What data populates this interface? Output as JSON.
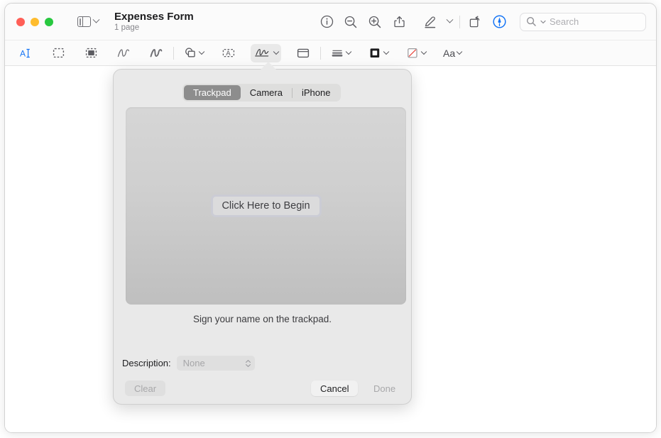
{
  "window": {
    "title": "Expenses Form",
    "subtitle": "1 page"
  },
  "traffic_lights": {
    "close": "close-button",
    "minimize": "minimize-button",
    "maximize": "maximize-button",
    "colors": {
      "close": "#ff5f57",
      "minimize": "#febc2e",
      "maximize": "#28c840"
    }
  },
  "titlebar": {
    "sidebar_toggle": "sidebar-toggle",
    "buttons": [
      {
        "name": "info-icon",
        "label": "Info"
      },
      {
        "name": "zoom-out-icon",
        "label": "Zoom Out"
      },
      {
        "name": "zoom-in-icon",
        "label": "Zoom In"
      },
      {
        "name": "share-icon",
        "label": "Share"
      },
      {
        "name": "highlight-pen-icon",
        "label": "Highlight"
      },
      {
        "name": "highlight-options-chevron-icon",
        "label": "Highlight Options"
      },
      {
        "name": "rotate-icon",
        "label": "Rotate"
      },
      {
        "name": "markup-icon",
        "label": "Show Markup Toolbar"
      }
    ]
  },
  "search": {
    "placeholder": "Search"
  },
  "markup_toolbar": {
    "tools": [
      {
        "name": "text-selection-icon",
        "label": "Text Selection",
        "active": true
      },
      {
        "name": "rectangular-selection-icon",
        "label": "Rectangular Selection",
        "active": false
      },
      {
        "name": "instant-alpha-icon",
        "label": "Instant Alpha",
        "active": false
      },
      {
        "name": "sketch-icon",
        "label": "Sketch",
        "active": false
      },
      {
        "name": "draw-icon",
        "label": "Draw",
        "active": false
      },
      {
        "name": "shapes-icon",
        "label": "Shapes",
        "active": false
      },
      {
        "name": "text-box-icon",
        "label": "Text",
        "active": false
      },
      {
        "name": "signature-icon",
        "label": "Sign",
        "active": true
      },
      {
        "name": "note-icon",
        "label": "Note",
        "active": false
      },
      {
        "name": "shape-style-icon",
        "label": "Shape Style",
        "active": false
      },
      {
        "name": "border-color-icon",
        "label": "Border Color",
        "active": false
      },
      {
        "name": "fill-color-icon",
        "label": "Fill Color",
        "active": false
      },
      {
        "name": "text-style-icon",
        "label": "Aa",
        "active": false
      }
    ],
    "text_style_label": "Aa"
  },
  "signature_popover": {
    "segments": [
      {
        "label": "Trackpad",
        "selected": true
      },
      {
        "label": "Camera",
        "selected": false
      },
      {
        "label": "iPhone",
        "selected": false
      }
    ],
    "begin_button": "Click Here to Begin",
    "hint": "Sign your name on the trackpad.",
    "description_label": "Description:",
    "description_value": "None",
    "buttons": {
      "clear": "Clear",
      "cancel": "Cancel",
      "done": "Done"
    }
  }
}
